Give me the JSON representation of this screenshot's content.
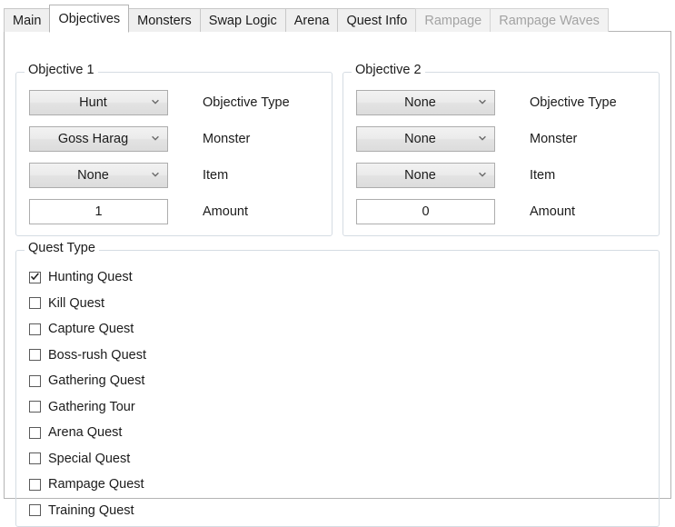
{
  "tabs": [
    {
      "label": "Main",
      "selected": false,
      "disabled": false
    },
    {
      "label": "Objectives",
      "selected": true,
      "disabled": false
    },
    {
      "label": "Monsters",
      "selected": false,
      "disabled": false
    },
    {
      "label": "Swap Logic",
      "selected": false,
      "disabled": false
    },
    {
      "label": "Arena",
      "selected": false,
      "disabled": false
    },
    {
      "label": "Quest Info",
      "selected": false,
      "disabled": false
    },
    {
      "label": "Rampage",
      "selected": false,
      "disabled": true
    },
    {
      "label": "Rampage Waves",
      "selected": false,
      "disabled": true
    }
  ],
  "objective1": {
    "title": "Objective 1",
    "fields": [
      {
        "label": "Objective Type",
        "value": "Hunt",
        "control": "combobox"
      },
      {
        "label": "Monster",
        "value": "Goss Harag",
        "control": "combobox"
      },
      {
        "label": "Item",
        "value": "None",
        "control": "combobox"
      },
      {
        "label": "Amount",
        "value": "1",
        "control": "textbox"
      }
    ]
  },
  "objective2": {
    "title": "Objective 2",
    "fields": [
      {
        "label": "Objective Type",
        "value": "None",
        "control": "combobox"
      },
      {
        "label": "Monster",
        "value": "None",
        "control": "combobox"
      },
      {
        "label": "Item",
        "value": "None",
        "control": "combobox"
      },
      {
        "label": "Amount",
        "value": "0",
        "control": "textbox"
      }
    ]
  },
  "quest_type": {
    "title": "Quest Type",
    "options": [
      {
        "label": "Hunting Quest",
        "checked": true
      },
      {
        "label": "Kill Quest",
        "checked": false
      },
      {
        "label": "Capture Quest",
        "checked": false
      },
      {
        "label": "Boss-rush Quest",
        "checked": false
      },
      {
        "label": "Gathering Quest",
        "checked": false
      },
      {
        "label": "Gathering Tour",
        "checked": false
      },
      {
        "label": "Arena Quest",
        "checked": false
      },
      {
        "label": "Special Quest",
        "checked": false
      },
      {
        "label": "Rampage Quest",
        "checked": false
      },
      {
        "label": "Training Quest",
        "checked": false
      }
    ]
  },
  "icons": {
    "chevron_down": "chevron-down-icon",
    "check": "check-icon"
  },
  "colors": {
    "panel_border": "#b4b4b4",
    "group_border": "#d5dce3",
    "control_border": "#adadad",
    "text": "#1b1b1b",
    "disabled_text": "#a3a3a3",
    "background": "#ffffff"
  }
}
